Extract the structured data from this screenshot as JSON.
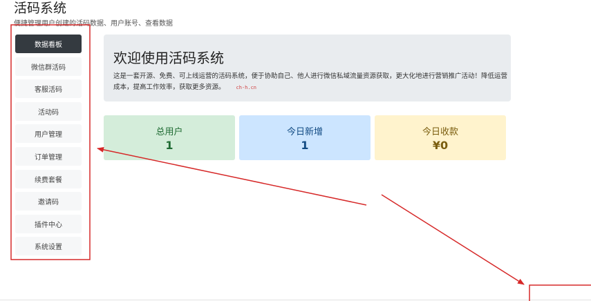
{
  "app": {
    "title": "活码系统",
    "subtitle": "便捷管理用户创建的活码数据、用户账号、查看数据"
  },
  "sidebar": {
    "items": [
      {
        "label": "数据看板",
        "active": true
      },
      {
        "label": "微信群活码"
      },
      {
        "label": "客服活码"
      },
      {
        "label": "活动码"
      },
      {
        "label": "用户管理"
      },
      {
        "label": "订单管理"
      },
      {
        "label": "续费套餐"
      },
      {
        "label": "邀请码"
      },
      {
        "label": "插件中心"
      },
      {
        "label": "系统设置"
      }
    ]
  },
  "hero": {
    "title": "欢迎使用活码系统",
    "description": "这是一套开源、免费、可上线运营的活码系统，便于协助自己、他人进行微信私域流量资源获取，更大化地进行营销推广活动！降低运营成本，提高工作效率，获取更多资源。",
    "watermark": "ch-h.cn"
  },
  "stats": {
    "users": {
      "label": "总用户",
      "value": "1"
    },
    "new_today": {
      "label": "今日新增",
      "value": "1"
    },
    "income_today": {
      "label": "今日收款",
      "value": "¥0"
    }
  },
  "colors": {
    "annotation": "#d62828",
    "sidebar_active": "#343a40",
    "stat_users_bg": "#d4edda",
    "stat_new_bg": "#cce5ff",
    "stat_income_bg": "#fff3cd"
  }
}
